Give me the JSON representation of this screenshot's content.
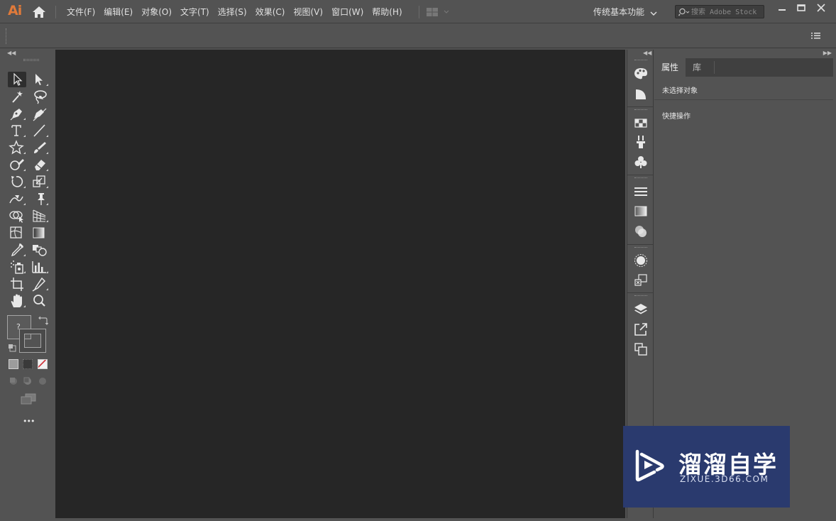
{
  "app": {
    "logo": "Ai"
  },
  "menubar": {
    "items": [
      {
        "label": "文件(F)"
      },
      {
        "label": "编辑(E)"
      },
      {
        "label": "对象(O)"
      },
      {
        "label": "文字(T)"
      },
      {
        "label": "选择(S)"
      },
      {
        "label": "效果(C)"
      },
      {
        "label": "视图(V)"
      },
      {
        "label": "窗口(W)"
      },
      {
        "label": "帮助(H)"
      }
    ],
    "workspace_label": "传统基本功能",
    "search": {
      "placeholder": "搜索 Adobe Stock",
      "value": ""
    }
  },
  "toolbar": {
    "fill_stroke_default": "?",
    "tools": [
      {
        "name": "selection-tool"
      },
      {
        "name": "direct-selection-tool"
      },
      {
        "name": "magic-wand-tool"
      },
      {
        "name": "lasso-tool"
      },
      {
        "name": "pen-tool"
      },
      {
        "name": "curvature-tool"
      },
      {
        "name": "type-tool"
      },
      {
        "name": "line-segment-tool"
      },
      {
        "name": "star-tool"
      },
      {
        "name": "paintbrush-tool"
      },
      {
        "name": "shaper-tool"
      },
      {
        "name": "eraser-tool"
      },
      {
        "name": "rotate-tool"
      },
      {
        "name": "scale-tool"
      },
      {
        "name": "width-tool"
      },
      {
        "name": "puppet-warp-tool"
      },
      {
        "name": "shape-builder-tool"
      },
      {
        "name": "perspective-grid-tool"
      },
      {
        "name": "mesh-tool"
      },
      {
        "name": "gradient-tool"
      },
      {
        "name": "eyedropper-tool"
      },
      {
        "name": "blend-tool"
      },
      {
        "name": "symbol-sprayer-tool"
      },
      {
        "name": "column-graph-tool"
      },
      {
        "name": "artboard-tool"
      },
      {
        "name": "slice-tool"
      },
      {
        "name": "hand-tool"
      },
      {
        "name": "zoom-tool"
      }
    ],
    "more_label": "•••"
  },
  "dock": {
    "icons": [
      "color-guide-icon",
      "color-icon",
      "swatches-icon",
      "brushes-icon",
      "symbols-icon",
      "stroke-icon",
      "gradient-icon",
      "transparency-icon",
      "appearance-icon",
      "graphic-styles-icon",
      "layers-icon",
      "export-icon",
      "artboards-icon"
    ]
  },
  "panel": {
    "tabs": [
      {
        "label": "属性",
        "active": true
      },
      {
        "label": "库",
        "active": false
      }
    ],
    "no_selection": "未选择对象",
    "quick_actions": "快捷操作"
  },
  "watermark": {
    "title": "溜溜自学",
    "url": "ZIXUE.3D66.COM"
  },
  "colors": {
    "chrome": "#535353",
    "canvas": "#262626",
    "logo": "#e07a3a",
    "watermark_bg": "#2a3a6e"
  }
}
